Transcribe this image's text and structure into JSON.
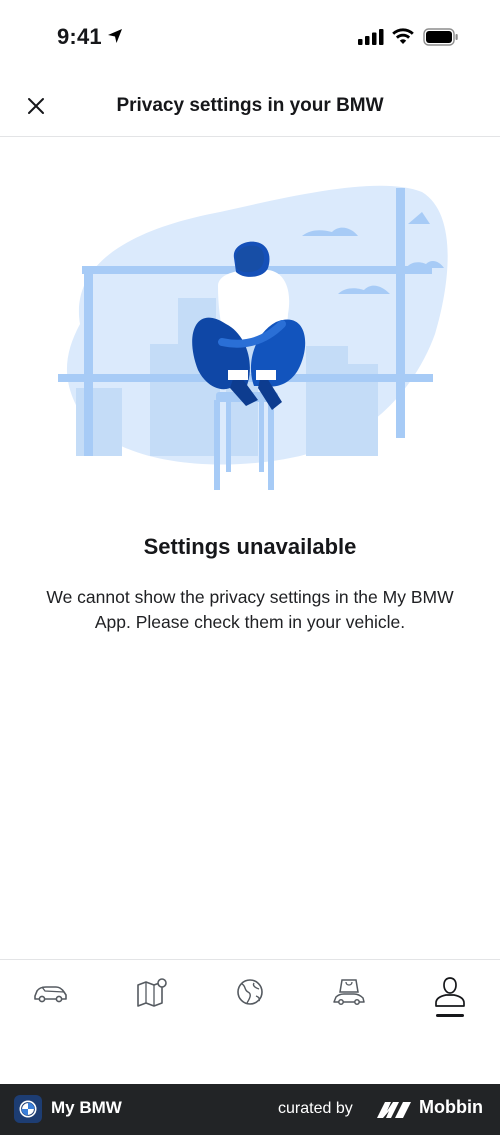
{
  "status_bar": {
    "time": "9:41"
  },
  "header": {
    "title": "Privacy settings in your BMW"
  },
  "empty_state": {
    "title": "Settings unavailable",
    "message": "We cannot show the privacy settings in the My BMW App. Please check them in your vehicle."
  },
  "tabs": [
    {
      "icon": "car-icon",
      "active": false
    },
    {
      "icon": "map-icon",
      "active": false
    },
    {
      "icon": "globe-icon",
      "active": false
    },
    {
      "icon": "shop-icon",
      "active": false
    },
    {
      "icon": "profile-icon",
      "active": true
    }
  ],
  "footer": {
    "app_name": "My BMW",
    "curated_label": "curated by",
    "brand": "Mobbin"
  },
  "colors": {
    "illustration_light": "#dbeafc",
    "illustration_mid": "#a7cbf6",
    "illustration_dark": "#1550b8",
    "text": "#16171a"
  }
}
